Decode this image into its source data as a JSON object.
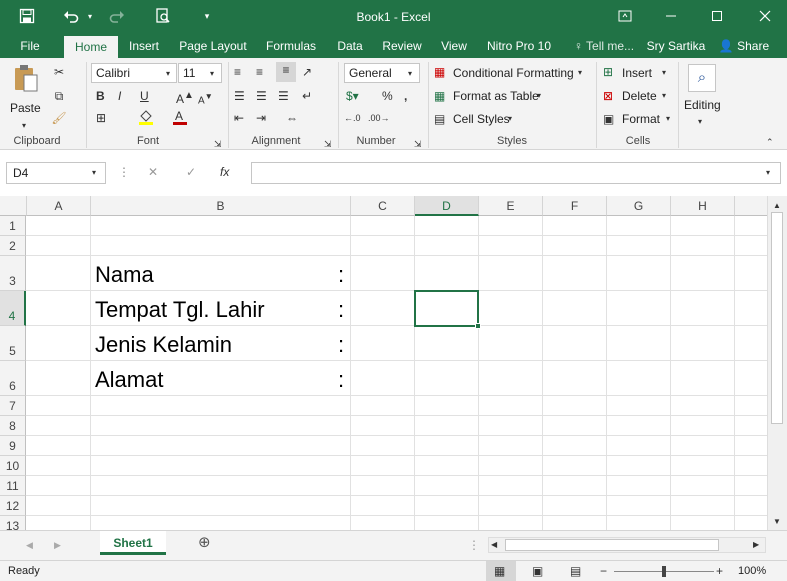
{
  "window": {
    "title": "Book1 - Excel",
    "user": "Sry Sartika",
    "share_label": "Share",
    "tell_me": "Tell me..."
  },
  "tabs": [
    "File",
    "Home",
    "Insert",
    "Page Layout",
    "Formulas",
    "Data",
    "Review",
    "View",
    "Nitro Pro 10"
  ],
  "active_tab": "Home",
  "ribbon": {
    "clipboard": {
      "label": "Clipboard",
      "paste": "Paste"
    },
    "font": {
      "label": "Font",
      "name": "Calibri",
      "size": "11"
    },
    "alignment": {
      "label": "Alignment"
    },
    "number": {
      "label": "Number",
      "format": "General"
    },
    "styles": {
      "label": "Styles",
      "conditional": "Conditional Formatting",
      "format_table": "Format as Table",
      "cell_styles": "Cell Styles"
    },
    "cells": {
      "label": "Cells",
      "insert": "Insert",
      "delete": "Delete",
      "format": "Format"
    },
    "editing": {
      "label": "Editing"
    }
  },
  "formula_bar": {
    "name_box": "D4",
    "formula": "",
    "fx": "fx"
  },
  "grid": {
    "columns": [
      "A",
      "B",
      "C",
      "D",
      "E",
      "F",
      "G",
      "H"
    ],
    "selected_col": "D",
    "rows": [
      "1",
      "2",
      "3",
      "4",
      "5",
      "6",
      "7",
      "8",
      "9",
      "10",
      "11",
      "12",
      "13"
    ],
    "selected_row": "4",
    "cells": [
      {
        "row": "3",
        "label": "Nama",
        "colon": ":"
      },
      {
        "row": "4",
        "label": "Tempat Tgl. Lahir",
        "colon": ":"
      },
      {
        "row": "5",
        "label": "Jenis Kelamin",
        "colon": ":"
      },
      {
        "row": "6",
        "label": "Alamat",
        "colon": ":"
      }
    ]
  },
  "sheets": [
    "Sheet1"
  ],
  "status": {
    "ready": "Ready",
    "zoom": "100%"
  }
}
